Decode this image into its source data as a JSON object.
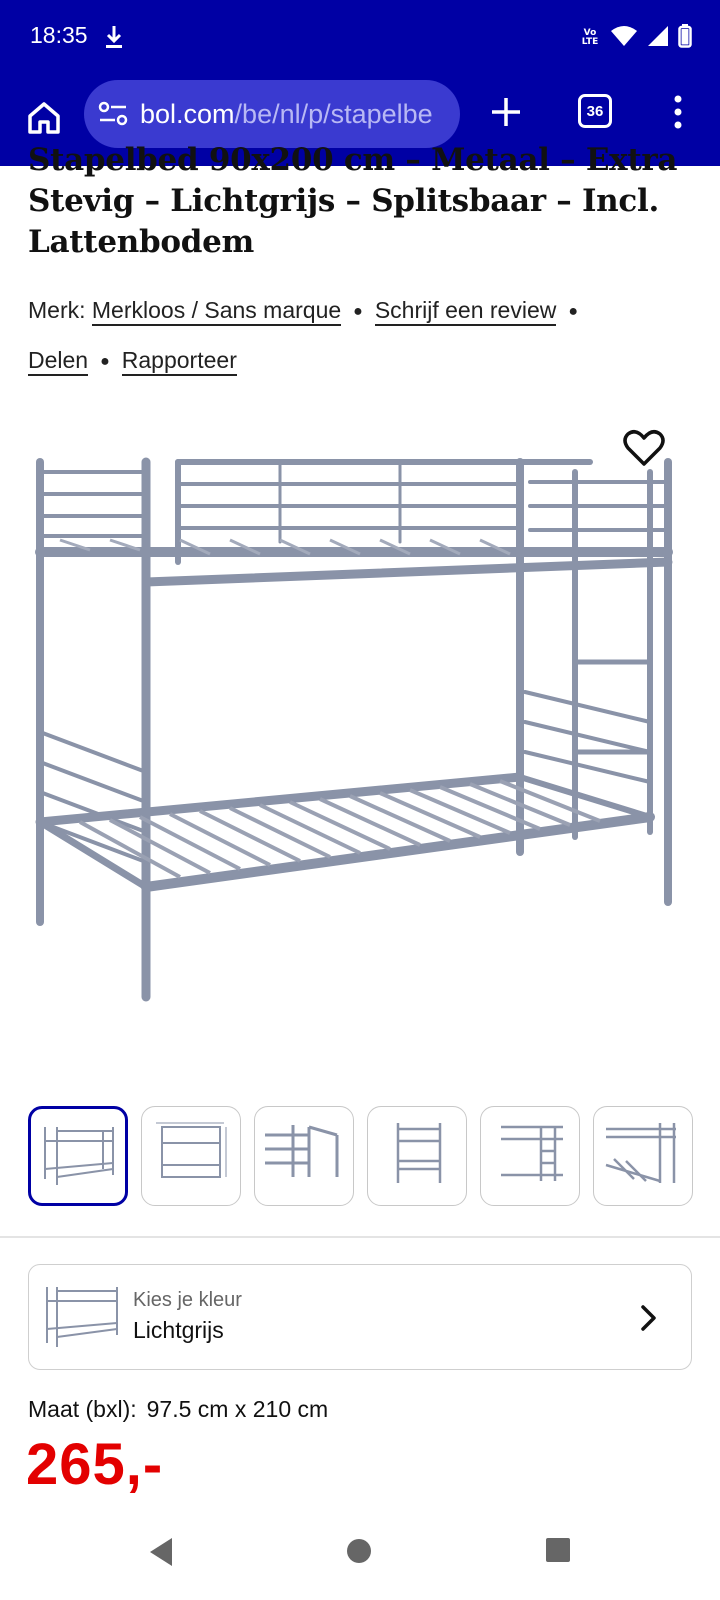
{
  "status_bar": {
    "time": "18:35",
    "download_icon": "download-icon",
    "network_label": "Vo LTE",
    "icons": [
      "volte-icon",
      "wifi-icon",
      "signal-icon",
      "battery-icon"
    ]
  },
  "browser": {
    "url_host": "bol.com",
    "url_path": "/be/nl/p/stapelbe",
    "tab_count": "36",
    "accent_color": "#0000a4"
  },
  "product": {
    "title": "Stapelbed 90x200 cm – Metaal – Extra Stevig – Lichtgrijs – Splitsbaar – Incl. Lattenbodem",
    "brand_prefix": "Merk:",
    "brand": "Merkloos / Sans marque",
    "review_link": "Schrijf een review",
    "share_link": "Delen",
    "report_link": "Rapporteer",
    "thumbnail_count": 6,
    "selected_thumbnail": 1
  },
  "color_selector": {
    "label": "Kies je kleur",
    "value": "Lichtgrijs"
  },
  "size": {
    "label": "Maat (bxl):",
    "value": "97.5 cm x 210 cm"
  },
  "price": {
    "value": "265,-",
    "color": "#e30000"
  }
}
